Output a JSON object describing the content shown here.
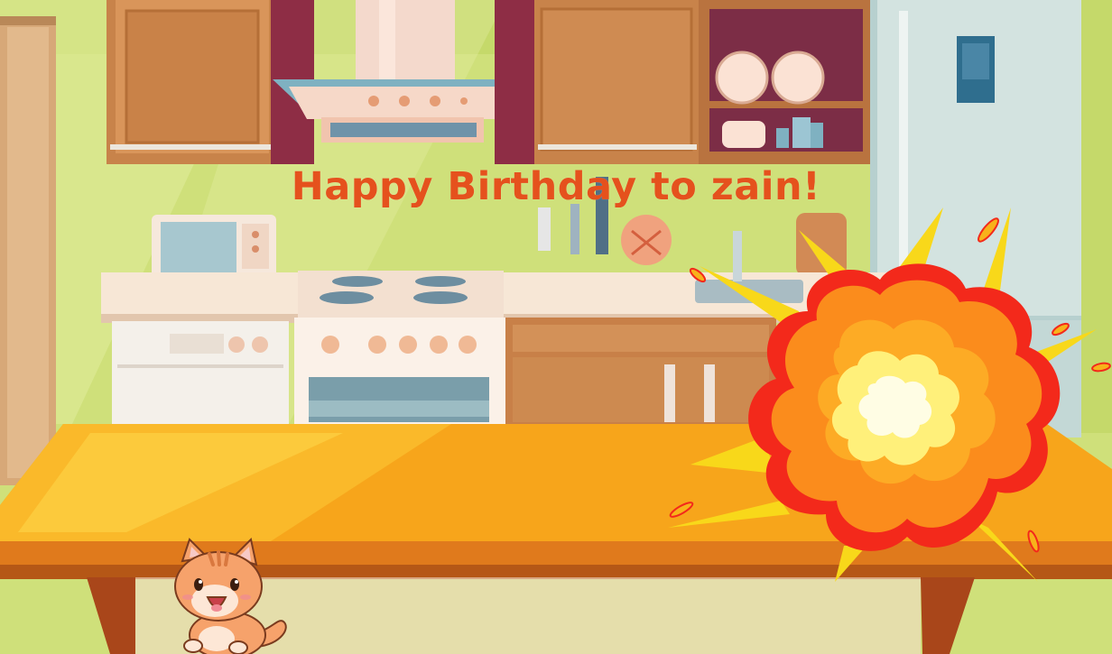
{
  "game": {
    "title_text": "Happy Birthday to zain!"
  },
  "scene": {
    "setting": "kitchen",
    "sprites": [
      "kitchen-background",
      "cat-sprite",
      "explosion-sprite"
    ]
  },
  "colors": {
    "title": "#e5511d",
    "wall": "#c9de6c",
    "table_top": "#f7a51b",
    "table_edge": "#c9671c",
    "explosion_outer": "#f3291b",
    "explosion_mid": "#f99f1e",
    "explosion_core": "#fff27a"
  }
}
